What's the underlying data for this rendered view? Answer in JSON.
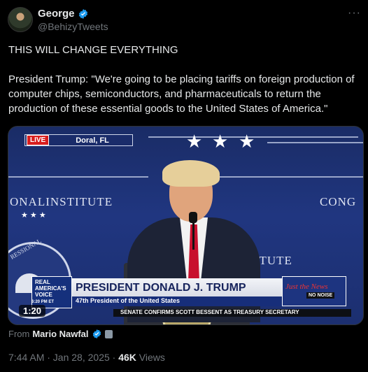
{
  "author": {
    "name": "George",
    "handle": "@BehizyTweets",
    "verified": true
  },
  "more_label": "···",
  "tweet": {
    "line1": "THIS WILL CHANGE EVERYTHING",
    "line2": "President Trump: \"We're going to be placing tariffs on foreign production of computer chips, semiconductors, and pharmaceuticals to return the production of these essential goods to the United States of America.\""
  },
  "video": {
    "live_label": "LIVE",
    "location": "Doral, FL",
    "bg_left": "ONALINSTITUTE",
    "bg_right": "CONG",
    "bg_right2": "STITUTE",
    "seal_text": "RESSIONAL",
    "logo_line1": "REAL\nAMERICA'S\nVOICE",
    "logo_time": "6:20 PM ET",
    "lower_third_name": "PRESIDENT DONALD J. TRUMP",
    "lower_third_sub": "47th President of the United States",
    "right_logo_1": "Just the News",
    "right_logo_2": "NO NOISE",
    "ticker": "SENATE CONFIRMS SCOTT BESSENT AS TREASURY SECRETARY",
    "duration": "1:20"
  },
  "from": {
    "prefix": "From",
    "source": "Mario Nawfal"
  },
  "meta": {
    "datetime": "7:44 AM · Jan 28, 2025 ·",
    "views_count": "46K",
    "views_label": "Views"
  },
  "colors": {
    "background": "#000000",
    "text": "#e7e9ea",
    "secondary": "#71767b",
    "verified": "#1d9bf0"
  },
  "icons": [
    "verified-badge-icon",
    "more-icon",
    "media-badge-icon"
  ]
}
